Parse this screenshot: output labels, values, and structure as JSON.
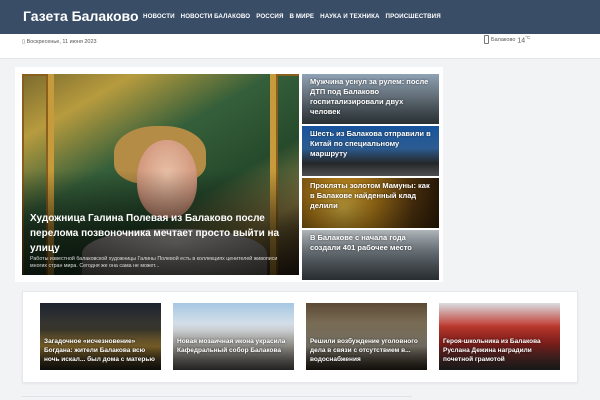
{
  "site": {
    "logo": "Газета Балаково"
  },
  "nav": [
    {
      "label": "НОВОСТИ"
    },
    {
      "label": "НОВОСТИ БАЛАКОВО"
    },
    {
      "label": "РОССИЯ"
    },
    {
      "label": "В МИРЕ"
    },
    {
      "label": "НАУКА И ТЕХНИКА"
    },
    {
      "label": "ПРОИСШЕСТВИЯ"
    }
  ],
  "topbar": {
    "date": "Воскресенье, 11 июня 2023",
    "weather_city": "Балаково",
    "weather_temp": "14",
    "weather_unit": "°C",
    "weather_icon": "weather-icon"
  },
  "hero": {
    "title": "Художница Галина Полевая из Балаково после перелома позвоночника мечтает просто выйти на улицу",
    "excerpt": "Работы известной балаковской художницы Галины Полевой есть в коллекциях ценителей живописи многих стран мира. Сегодня же она сама не может..."
  },
  "side_posts": [
    {
      "title": "Мужчина уснул за рулем: после ДТП под Балаково госпитализировали двух человек"
    },
    {
      "title": "Шесть из Балакова отправили в Китай по специальному маршруту"
    },
    {
      "title": "Прокляты золотом Мамуны: как в Балакове найденный клад делили"
    },
    {
      "title": "В Балакове с начала года создали 401 рабочее место"
    }
  ],
  "cards": [
    {
      "title": "Загадочное «исчезновение» Богдана: жители Балакова всю ночь искал... был дома с матерью"
    },
    {
      "title": "Новая мозаичная икона украсила Кафедральный собор Балакова"
    },
    {
      "title": "Решили возбуждение уголовного дела в связи с отсутствием в... водоснабжения"
    },
    {
      "title": "Героя-школьника из Балакова Руслана Дежина наградили почетной грамотой"
    }
  ]
}
